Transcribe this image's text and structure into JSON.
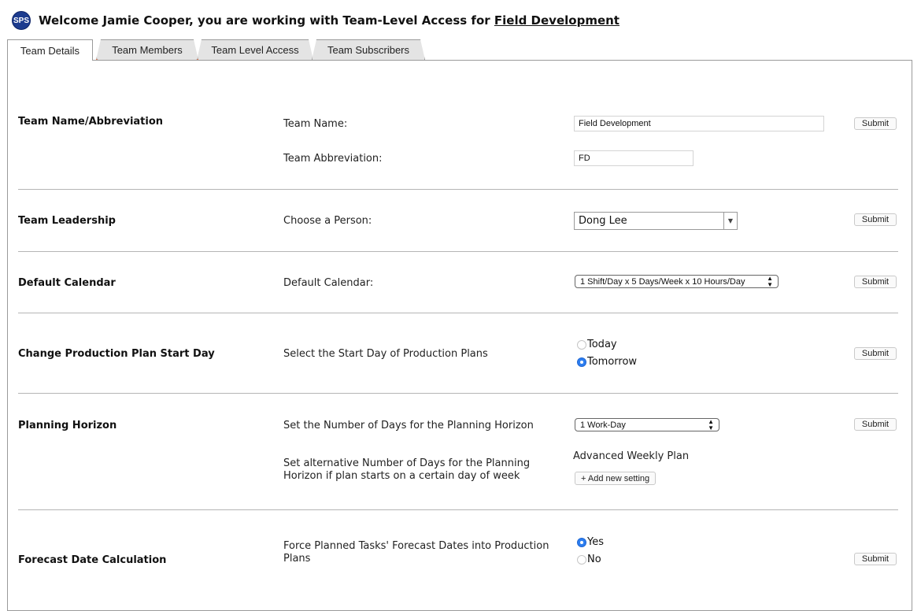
{
  "header": {
    "logo": "SPS",
    "welcome_prefix": "Welcome Jamie Cooper, you are working with Team-Level Access for ",
    "team_link": "Field Development"
  },
  "tabs": [
    {
      "label": "Team Details",
      "active": true
    },
    {
      "label": "Team Members",
      "highlighted": true
    },
    {
      "label": "Team Level Access"
    },
    {
      "label": "Team Subscribers"
    }
  ],
  "sections": {
    "team_name": {
      "title": "Team Name/Abbreviation",
      "name_label": "Team Name:",
      "name_value": "Field Development",
      "abbr_label": "Team Abbreviation:",
      "abbr_value": "FD",
      "submit": "Submit"
    },
    "leadership": {
      "title": "Team Leadership",
      "label": "Choose a Person:",
      "value": "Dong Lee",
      "submit": "Submit"
    },
    "calendar": {
      "title": "Default Calendar",
      "label": "Default Calendar:",
      "value": "1 Shift/Day x 5 Days/Week x 10 Hours/Day",
      "submit": "Submit"
    },
    "start_day": {
      "title": "Change Production Plan Start Day",
      "label": "Select the Start Day of Production Plans",
      "options": [
        "Today",
        "Tomorrow"
      ],
      "selected": "Tomorrow",
      "submit": "Submit"
    },
    "horizon": {
      "title": "Planning Horizon",
      "label": "Set the Number of Days for the Planning Horizon",
      "value": "1 Work-Day",
      "alt_label_1": "Set alternative Number of Days for the Planning",
      "alt_label_2": "Horizon if plan starts on a certain day of week",
      "advanced": "Advanced Weekly Plan",
      "add_setting": "+ Add new setting",
      "submit": "Submit"
    },
    "forecast": {
      "title": "Forecast Date Calculation",
      "label_1": "Force Planned Tasks' Forecast Dates into Production",
      "label_2": "Plans",
      "options": [
        "Yes",
        "No"
      ],
      "selected": "Yes",
      "submit": "Submit"
    }
  },
  "colors": {
    "accent_radio": "#2d7ef0",
    "tab_highlight": "#e0653a",
    "logo_bg": "#1d3c8f"
  }
}
